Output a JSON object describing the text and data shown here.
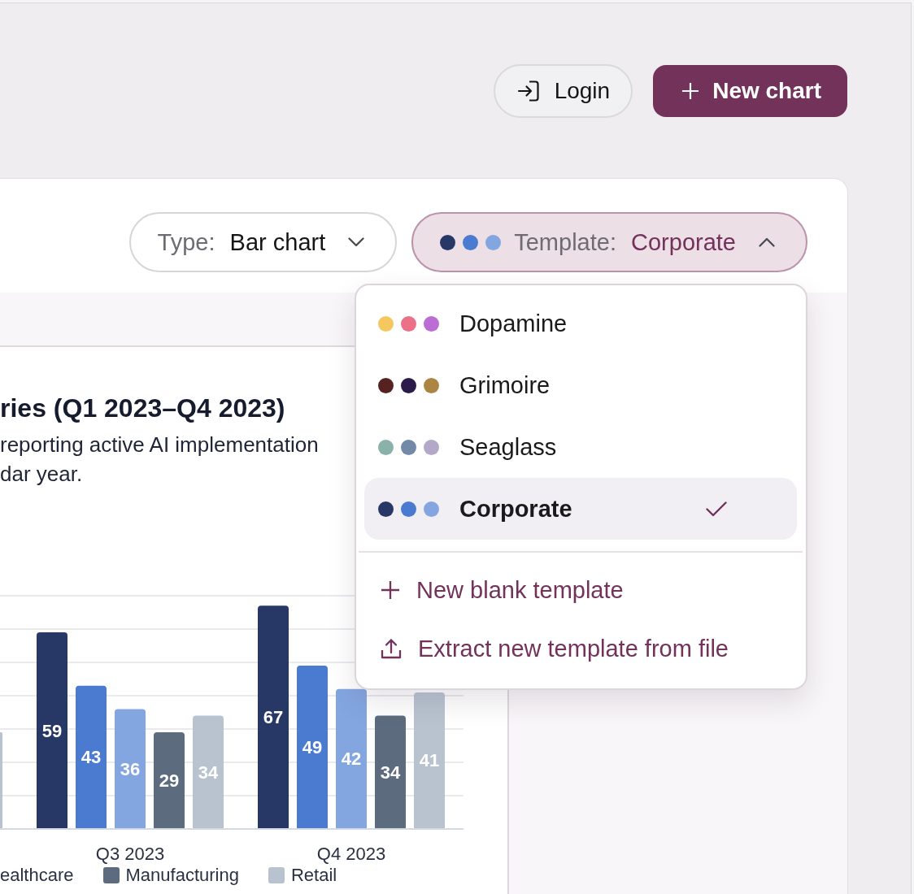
{
  "header": {
    "buttons": [
      {
        "kind": "login",
        "label": "Login"
      },
      {
        "kind": "create",
        "label": "New chart"
      }
    ]
  },
  "toolbar": {
    "type_select": {
      "label": "Type:",
      "value": "Bar chart",
      "expanded": false
    },
    "template_select": {
      "palette": [
        {
          "color": "#273766"
        },
        {
          "color": "#4a7bd0"
        },
        {
          "color": "#84a6e0"
        }
      ],
      "label": "Template:",
      "value": "Corporate",
      "expanded": true
    }
  },
  "template_menu": {
    "items": [
      {
        "name": "Dopamine",
        "palette": [
          {
            "color": "#f5c85f"
          },
          {
            "color": "#ec7088"
          },
          {
            "color": "#bb6cd5"
          }
        ],
        "selected": false
      },
      {
        "name": "Grimoire",
        "palette": [
          {
            "color": "#562220"
          },
          {
            "color": "#2c1b4a"
          },
          {
            "color": "#ad8543"
          }
        ],
        "selected": false
      },
      {
        "name": "Seaglass",
        "palette": [
          {
            "color": "#8bb2aa"
          },
          {
            "color": "#7289a8"
          },
          {
            "color": "#b4a8c8"
          }
        ],
        "selected": false
      },
      {
        "name": "Corporate",
        "palette": [
          {
            "color": "#273766"
          },
          {
            "color": "#4a7bd0"
          },
          {
            "color": "#84a6e0"
          }
        ],
        "selected": true
      }
    ],
    "actions": [
      {
        "kind": "add",
        "label": "New blank template"
      },
      {
        "kind": "upload",
        "label": "Extract new template from file"
      }
    ]
  },
  "chart": {
    "title": "ries (Q1 2023–Q4 2023)",
    "subtitle_lines": [
      "reporting active AI implementation",
      "dar year."
    ],
    "chart_data": {
      "type": "bar",
      "categories": [
        null,
        "Q3 2023",
        "Q4 2023"
      ],
      "series": [
        {
          "color": "#273766",
          "values": [
            null,
            59,
            67
          ],
          "value_labels": [
            null,
            "59",
            "67"
          ]
        },
        {
          "color": "#4a7bd0",
          "values": [
            null,
            43,
            49
          ],
          "value_labels": [
            null,
            "43",
            "49"
          ]
        },
        {
          "color": "#84a6e0",
          "values": [
            null,
            36,
            42
          ],
          "value_labels": [
            null,
            "36",
            "42"
          ]
        },
        {
          "color": "#5d6b7e",
          "values": [
            null,
            29,
            34
          ],
          "value_labels": [
            null,
            "29",
            "34"
          ]
        },
        {
          "color": "#b9c3d0",
          "values": [
            29,
            34,
            41
          ],
          "value_labels": [
            null,
            "34",
            "41"
          ]
        }
      ]
    },
    "legend": [
      {
        "label": "ealthcare"
      },
      {
        "label": "Manufacturing",
        "color": "#5d6b7e"
      },
      {
        "label": "Retail",
        "color": "#b9c3d0"
      }
    ]
  }
}
